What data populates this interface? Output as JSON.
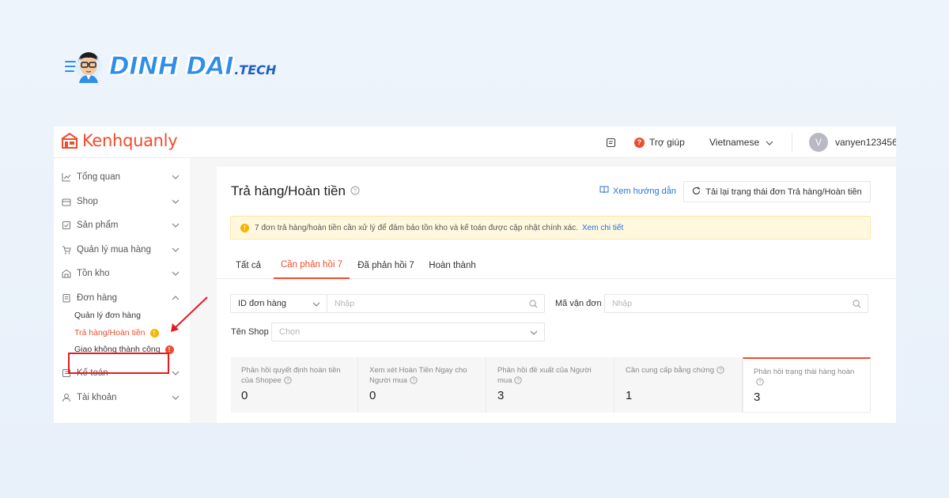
{
  "brand": {
    "word": "DINH DAI",
    "suffix": ".TECH"
  },
  "app": {
    "logo_text": "Kenhquanly",
    "topbar": {
      "help_label": "Trợ giúp",
      "language": "Vietnamese",
      "avatar_letter": "V",
      "username": "vanyen123456"
    },
    "sidebar": {
      "items": [
        {
          "label": "Tổng quan",
          "icon": "chart-icon"
        },
        {
          "label": "Shop",
          "icon": "shop-icon"
        },
        {
          "label": "Sản phẩm",
          "icon": "product-icon"
        },
        {
          "label": "Quản lý mua hàng",
          "icon": "cart-icon"
        },
        {
          "label": "Tồn kho",
          "icon": "warehouse-icon"
        },
        {
          "label": "Đơn hàng",
          "icon": "order-icon"
        },
        {
          "label": "Kế toán",
          "icon": "accounting-icon"
        },
        {
          "label": "Tài khoản",
          "icon": "user-icon"
        }
      ],
      "order_sub": [
        {
          "label": "Quản lý đơn hàng"
        },
        {
          "label": "Trả hàng/Hoàn tiền",
          "badge": "!"
        },
        {
          "label": "Giao không thành công",
          "badge": "!"
        }
      ]
    },
    "main": {
      "title": "Trả hàng/Hoàn tiền",
      "guide_link": "Xem hướng dẫn",
      "reload_button": "Tải lại trạng thái đơn Trả hàng/Hoàn tiền",
      "alert": {
        "text": "7 đơn trả hàng/hoàn tiền cần xử lý để đảm bảo tồn kho và kế toán được cập nhật chính xác.",
        "link": "Xem chi tiết"
      },
      "tabs": [
        {
          "label": "Tất cả"
        },
        {
          "label": "Cần phản hồi 7"
        },
        {
          "label": "Đã phản hồi 7"
        },
        {
          "label": "Hoàn thành"
        }
      ],
      "filters": {
        "id_select": "ID đơn hàng",
        "id_placeholder": "Nhập",
        "tracking_label": "Mã vận đơn",
        "tracking_placeholder": "Nhập",
        "shop_label": "Tên Shop",
        "shop_placeholder": "Chọn"
      },
      "stats": [
        {
          "label": "Phản hồi quyết định hoàn tiền của Shopee",
          "value": "0"
        },
        {
          "label": "Xem xét Hoàn Tiền Ngay cho Người mua",
          "value": "0"
        },
        {
          "label": "Phản hồi đề xuất của Người mua",
          "value": "3"
        },
        {
          "label": "Cần cung cấp bằng chứng",
          "value": "1"
        },
        {
          "label": "Phản hồi trạng thái hàng hoàn",
          "value": "3"
        }
      ]
    }
  },
  "colors": {
    "accent": "#ee4d2d",
    "link": "#2673dd",
    "highlight": "#e6191f",
    "warning": "#f7b500"
  }
}
